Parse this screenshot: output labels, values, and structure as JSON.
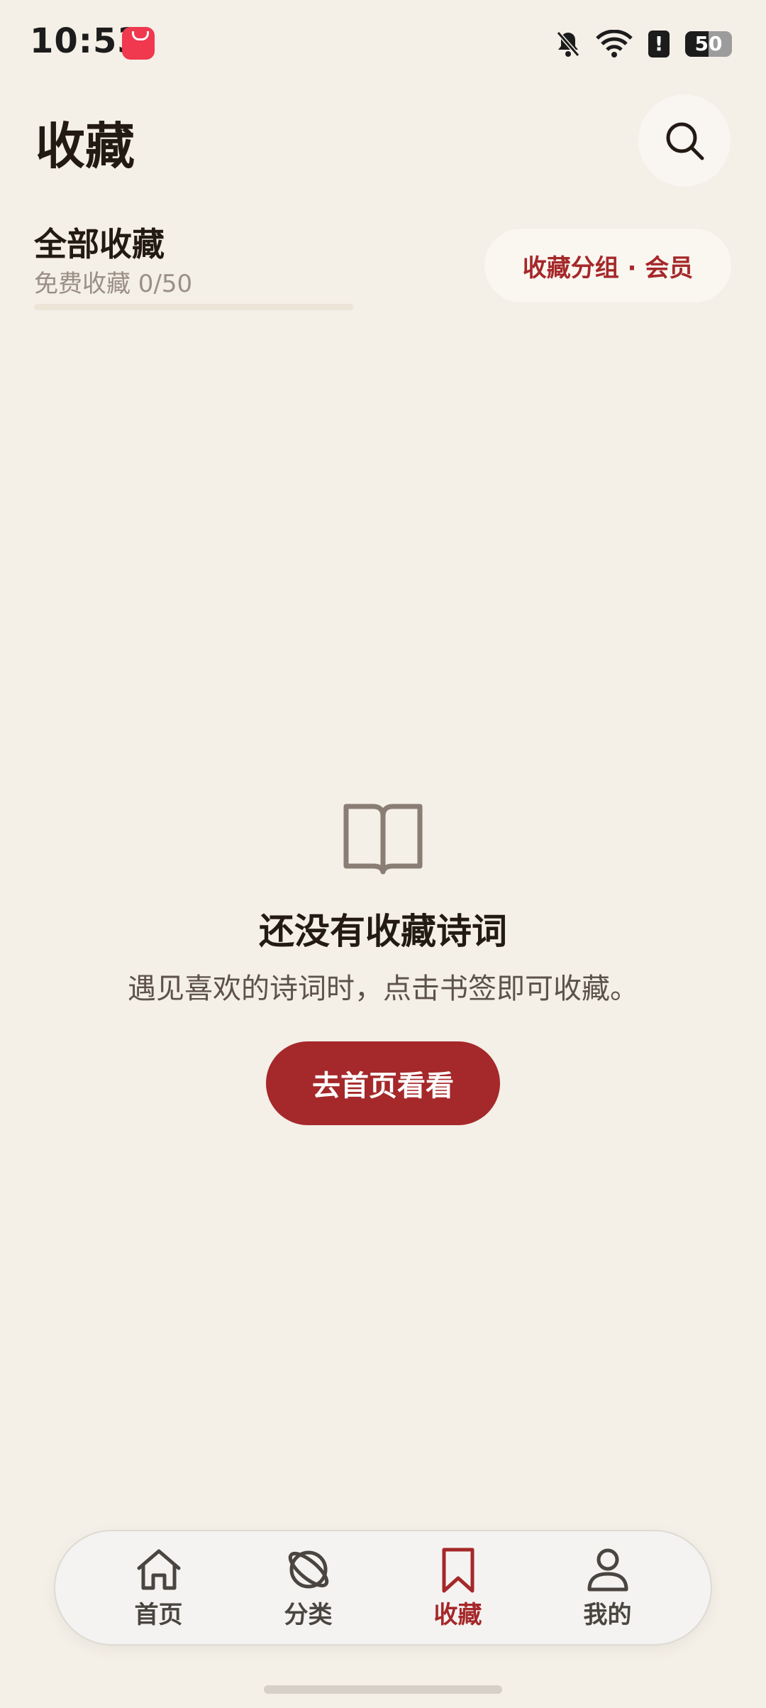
{
  "status": {
    "time": "10:53",
    "battery": "50",
    "battery_level": 0.5,
    "alert": "!"
  },
  "header": {
    "title": "收藏"
  },
  "collection": {
    "title": "全部收藏",
    "subtitle": "免费收藏 0/50",
    "used": 0,
    "limit": 50,
    "group_button": "收藏分组 · 会员"
  },
  "empty_state": {
    "icon": "book-icon",
    "title": "还没有收藏诗词",
    "description": "遇见喜欢的诗词时，点击书签即可收藏。",
    "button": "去首页看看"
  },
  "nav": {
    "items": [
      {
        "label": "首页",
        "icon": "home-icon",
        "active": false
      },
      {
        "label": "分类",
        "icon": "planet-icon",
        "active": false
      },
      {
        "label": "收藏",
        "icon": "bookmark-icon",
        "active": true
      },
      {
        "label": "我的",
        "icon": "person-icon",
        "active": false
      }
    ]
  },
  "colors": {
    "accent": "#a5282a",
    "background": "#f4efe7"
  }
}
